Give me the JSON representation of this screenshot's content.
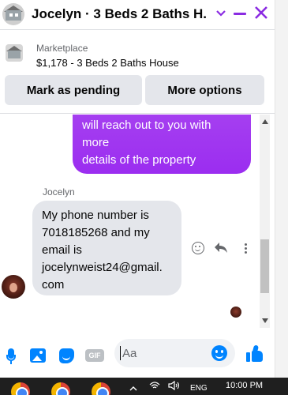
{
  "header": {
    "title": "Jocelyn · 3 Beds 2 Baths H...",
    "accent_color": "#8a2be2",
    "controls": [
      "chevron-down-icon",
      "minimize-icon",
      "close-icon"
    ]
  },
  "marketplace": {
    "source": "Marketplace",
    "listing": "$1,178 - 3 Beds 2 Baths House"
  },
  "actions": {
    "pending_label": "Mark as pending",
    "more_label": "More options"
  },
  "messages": {
    "outgoing_text": "will reach out to you with\nmore\ndetails of the property",
    "outgoing_color": "#9b2df0",
    "sender_name": "Jocelyn",
    "incoming_text": "My phone number is\n7018185268 and my\nemail is\njocelynweist24@gmail.\ncom"
  },
  "composer": {
    "placeholder": "Aa",
    "gif_label": "GIF",
    "icons": [
      "microphone-icon",
      "image-icon",
      "sticker-icon",
      "gif-icon",
      "emoji-icon",
      "thumbs-up-icon"
    ],
    "accent_color": "#0084ff"
  },
  "taskbar": {
    "time": "10:00 PM",
    "language": "ENG",
    "apps": [
      "chrome-icon",
      "chrome-icon",
      "chrome-icon"
    ]
  }
}
